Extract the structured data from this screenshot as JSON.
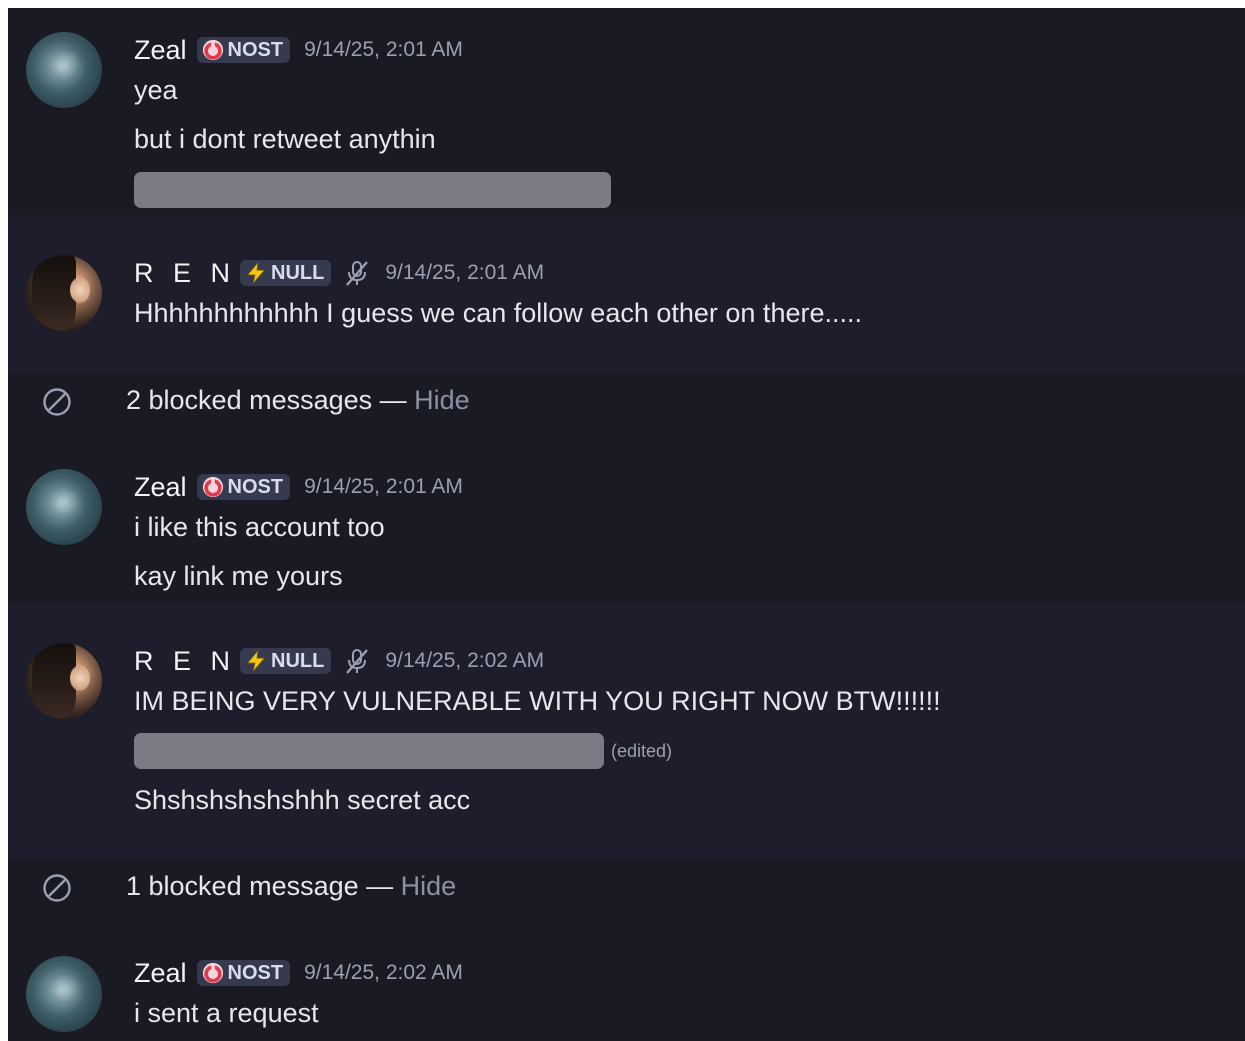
{
  "colors": {
    "background": "#1a1a25",
    "highlight_row": "#1e1d2b",
    "tag_background": "#363a4e",
    "spoiler": "#7b7b85",
    "muted_text": "#9aa0b1"
  },
  "messages": [
    {
      "username": "Zeal",
      "tag_icon": "nost-ring-icon",
      "tag": "NOST",
      "timestamp": "9/14/25, 2:01 AM",
      "lines": [
        "yea",
        "but i dont retweet anythin"
      ],
      "spoiler": "hidden-spoiler"
    },
    {
      "username": "R E N",
      "tag_icon": "lightning-icon",
      "tag": "NULL",
      "status_icon": "muted-mic-icon",
      "timestamp": "9/14/25, 2:01 AM",
      "lines": [
        "Hhhhhhhhhhhh I guess we can follow each other on there....."
      ]
    },
    {
      "username": "Zeal",
      "tag_icon": "nost-ring-icon",
      "tag": "NOST",
      "timestamp": "9/14/25, 2:01 AM",
      "lines": [
        "i like this account too",
        "kay link me yours"
      ]
    },
    {
      "username": "R E N",
      "tag_icon": "lightning-icon",
      "tag": "NULL",
      "status_icon": "muted-mic-icon",
      "timestamp": "9/14/25, 2:02 AM",
      "lines": [
        "IM BEING VERY VULNERABLE WITH YOU RIGHT NOW BTW!!!!!!",
        "Shshshshshshhh secret acc"
      ],
      "edited_label": "(edited)"
    },
    {
      "username": "Zeal",
      "tag_icon": "nost-ring-icon",
      "tag": "NOST",
      "timestamp": "9/14/25, 2:02 AM",
      "lines": [
        "i sent a request"
      ]
    }
  ],
  "blocked": [
    {
      "text": "2 blocked messages — ",
      "action": "Hide"
    },
    {
      "text": "1 blocked message — ",
      "action": "Hide"
    }
  ]
}
